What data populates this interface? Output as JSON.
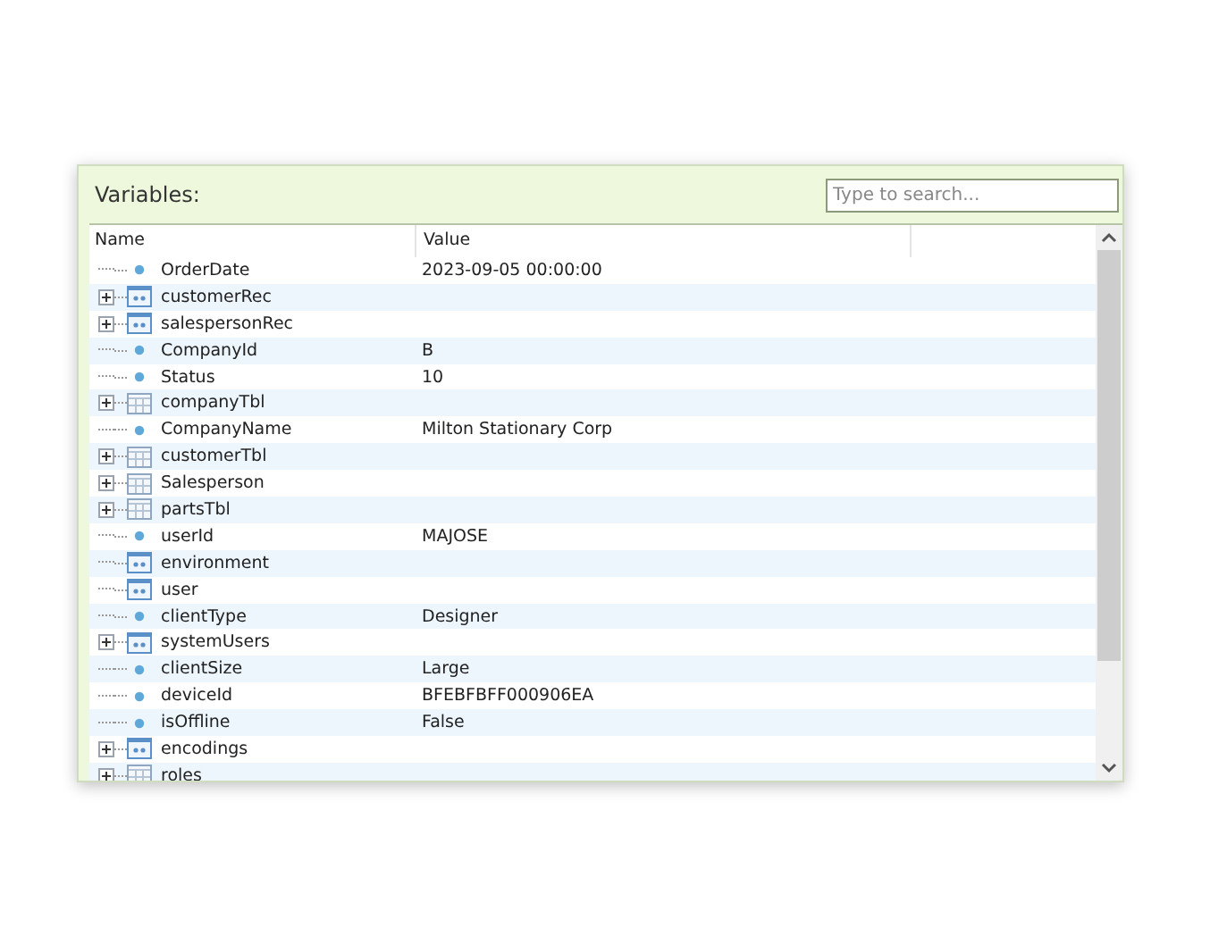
{
  "panel": {
    "title": "Variables:",
    "search": {
      "placeholder": "Type to search..."
    }
  },
  "table": {
    "columns": [
      "Name",
      "Value"
    ],
    "rows": [
      {
        "name": "OrderDate",
        "value": "2023-09-05 00:00:00",
        "kind": "field",
        "expandable": false
      },
      {
        "name": "customerRec",
        "kind": "record",
        "expandable": true
      },
      {
        "name": "salespersonRec",
        "kind": "record",
        "expandable": true
      },
      {
        "name": "CompanyId",
        "value": "B",
        "kind": "field",
        "expandable": false
      },
      {
        "name": "Status",
        "value": "10",
        "kind": "field",
        "expandable": false
      },
      {
        "name": "companyTbl",
        "kind": "table",
        "expandable": true
      },
      {
        "name": "CompanyName",
        "value": "Milton Stationary Corp",
        "kind": "field",
        "expandable": false
      },
      {
        "name": "customerTbl",
        "kind": "table",
        "expandable": true
      },
      {
        "name": "Salesperson",
        "kind": "table",
        "expandable": true
      },
      {
        "name": "partsTbl",
        "kind": "table",
        "expandable": true
      },
      {
        "name": "userId",
        "value": "MAJOSE",
        "kind": "field",
        "expandable": false
      },
      {
        "name": "environment",
        "kind": "record",
        "expandable": false
      },
      {
        "name": "user",
        "kind": "record",
        "expandable": false
      },
      {
        "name": "clientType",
        "value": "Designer",
        "kind": "field",
        "expandable": false
      },
      {
        "name": "systemUsers",
        "kind": "record",
        "expandable": true
      },
      {
        "name": "clientSize",
        "value": "Large",
        "kind": "field",
        "expandable": false
      },
      {
        "name": "deviceId",
        "value": "BFEBFBFF000906EA",
        "kind": "field",
        "expandable": false
      },
      {
        "name": "isOffline",
        "value": "False",
        "kind": "field",
        "expandable": false
      },
      {
        "name": "encodings",
        "kind": "record",
        "expandable": true
      },
      {
        "name": "roles",
        "kind": "table",
        "expandable": true
      }
    ]
  }
}
